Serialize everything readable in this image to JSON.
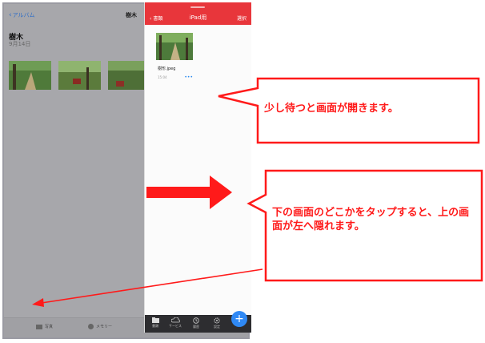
{
  "photos": {
    "back_label": "アルバム",
    "title": "樹木",
    "album_name": "樹木",
    "album_date": "9月14日",
    "tabs": [
      {
        "label": "写真"
      },
      {
        "label": "メモリー"
      }
    ]
  },
  "ipad_panel": {
    "back_label": "書類",
    "title": "iPad用",
    "select_label": "選択",
    "file": {
      "name": "樹形.jpeg",
      "time": "15:04",
      "menu": "•••"
    },
    "toolbar": [
      {
        "label": "書類",
        "icon": "folder-icon"
      },
      {
        "label": "サービス",
        "icon": "cloud-icon"
      },
      {
        "label": "履歴",
        "icon": "clock-icon"
      },
      {
        "label": "設定",
        "icon": "gear-icon"
      }
    ],
    "fab_label": "+"
  },
  "callouts": {
    "top": "少し待つと画面が開きます。",
    "bottom": "下の画面のどこかをタップすると、上の画面が左へ隠れます。"
  },
  "colors": {
    "accent_red": "#e8363b",
    "annotation_red": "#ff1a1a",
    "fab_blue": "#2f89f5"
  }
}
